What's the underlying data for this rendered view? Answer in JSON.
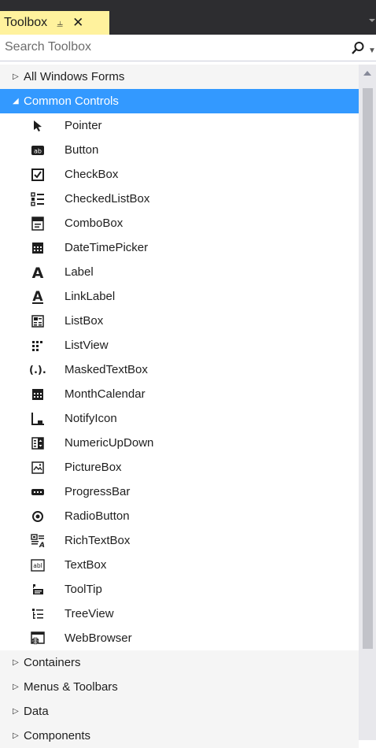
{
  "title": "Toolbox",
  "search": {
    "placeholder": "Search Toolbox"
  },
  "categories_top": [
    {
      "label": "All Windows Forms"
    }
  ],
  "open_category": {
    "label": "Common Controls"
  },
  "items": [
    {
      "label": "Pointer",
      "icon": "pointer-icon"
    },
    {
      "label": "Button",
      "icon": "button-icon"
    },
    {
      "label": "CheckBox",
      "icon": "checkbox-icon"
    },
    {
      "label": "CheckedListBox",
      "icon": "checkedlistbox-icon"
    },
    {
      "label": "ComboBox",
      "icon": "combobox-icon"
    },
    {
      "label": "DateTimePicker",
      "icon": "datetimepicker-icon"
    },
    {
      "label": "Label",
      "icon": "label-icon"
    },
    {
      "label": "LinkLabel",
      "icon": "linklabel-icon"
    },
    {
      "label": "ListBox",
      "icon": "listbox-icon"
    },
    {
      "label": "ListView",
      "icon": "listview-icon"
    },
    {
      "label": "MaskedTextBox",
      "icon": "maskedtextbox-icon"
    },
    {
      "label": "MonthCalendar",
      "icon": "monthcalendar-icon"
    },
    {
      "label": "NotifyIcon",
      "icon": "notifyicon-icon"
    },
    {
      "label": "NumericUpDown",
      "icon": "numericupdown-icon"
    },
    {
      "label": "PictureBox",
      "icon": "picturebox-icon"
    },
    {
      "label": "ProgressBar",
      "icon": "progressbar-icon"
    },
    {
      "label": "RadioButton",
      "icon": "radiobutton-icon"
    },
    {
      "label": "RichTextBox",
      "icon": "richtextbox-icon"
    },
    {
      "label": "TextBox",
      "icon": "textbox-icon"
    },
    {
      "label": "ToolTip",
      "icon": "tooltip-icon"
    },
    {
      "label": "TreeView",
      "icon": "treeview-icon"
    },
    {
      "label": "WebBrowser",
      "icon": "webbrowser-icon"
    }
  ],
  "categories_bottom": [
    {
      "label": "Containers"
    },
    {
      "label": "Menus & Toolbars"
    },
    {
      "label": "Data"
    },
    {
      "label": "Components"
    }
  ],
  "colors": {
    "selected": "#3399ff",
    "title_bg": "#2d2d30",
    "tab_bg": "#fff29d"
  }
}
